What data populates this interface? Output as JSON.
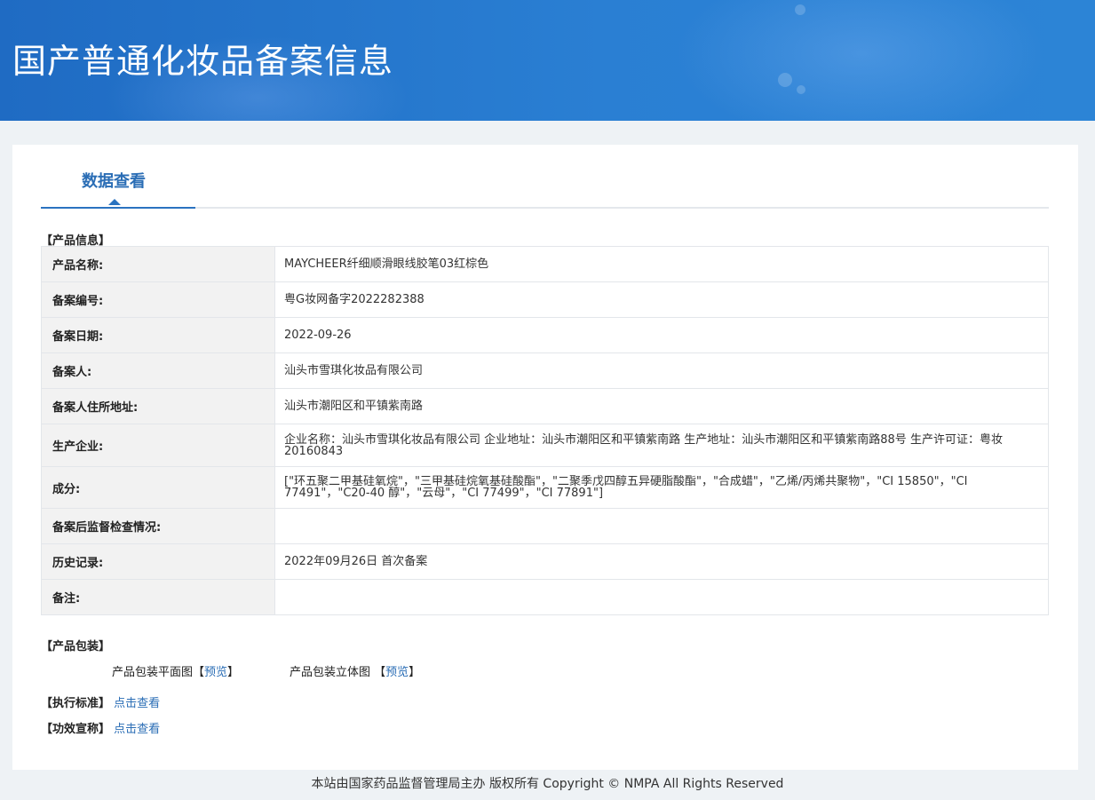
{
  "header": {
    "title": "国产普通化妆品备案信息"
  },
  "tabs": {
    "active_label": "数据查看"
  },
  "product_info": {
    "section_label": "【产品信息】",
    "rows": [
      {
        "label": "产品名称:",
        "value": "MAYCHEER纤细顺滑眼线胶笔03红棕色"
      },
      {
        "label": "备案编号:",
        "value": "粤G妆网备字2022282388"
      },
      {
        "label": "备案日期:",
        "value": "2022-09-26"
      },
      {
        "label": "备案人:",
        "value": "汕头市雪琪化妆品有限公司"
      },
      {
        "label": "备案人住所地址:",
        "value": "汕头市潮阳区和平镇紫南路"
      },
      {
        "label": "生产企业:",
        "value": "企业名称：汕头市雪琪化妆品有限公司 企业地址：汕头市潮阳区和平镇紫南路 生产地址：汕头市潮阳区和平镇紫南路88号 生产许可证：粤妆20160843"
      },
      {
        "label": "成分:",
        "value": "[\"环五聚二甲基硅氧烷\"，\"三甲基硅烷氧基硅酸酯\"，\"二聚季戊四醇五异硬脂酸酯\"，\"合成蜡\"，\"乙烯/丙烯共聚物\"，\"CI 15850\"，\"CI 77491\"，\"C20-40 醇\"，\"云母\"，\"CI 77499\"，\"CI 77891\"]"
      },
      {
        "label": "备案后监督检查情况:",
        "value": ""
      },
      {
        "label": "历史记录:",
        "value": "2022年09月26日 首次备案"
      },
      {
        "label": "备注:",
        "value": ""
      }
    ]
  },
  "packaging": {
    "section_label": "【产品包装】",
    "flat_label": "产品包装平面图【",
    "flat_link": "预览",
    "flat_close": "】",
    "stereo_label": "产品包装立体图 【",
    "stereo_link": "预览",
    "stereo_close": "】"
  },
  "standard": {
    "section_label": "【执行标准】",
    "link": "点击查看"
  },
  "efficacy": {
    "section_label": "【功效宣称】",
    "link": "点击查看"
  },
  "footer": {
    "text": "本站由国家药品监督管理局主办 版权所有 Copyright © NMPA All Rights Reserved"
  }
}
